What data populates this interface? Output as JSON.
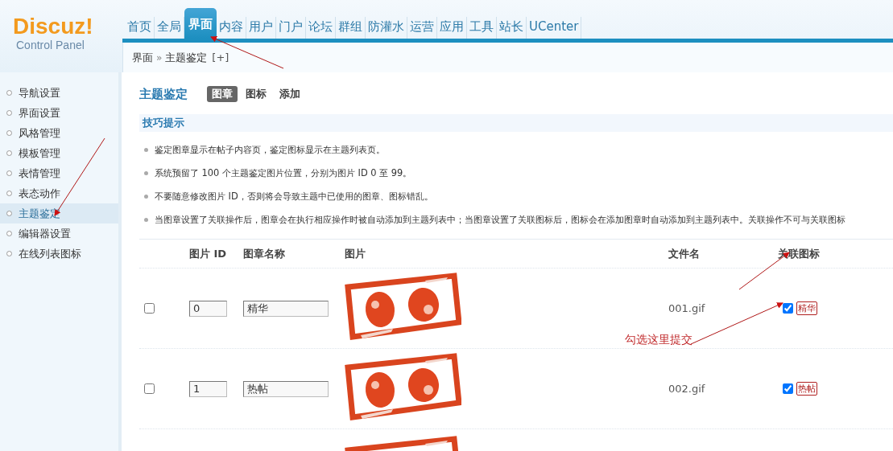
{
  "logo": {
    "name": "Discuz!",
    "subtitle": "Control Panel"
  },
  "nav": [
    {
      "label": "首页",
      "selected": false
    },
    {
      "label": "全局",
      "selected": false
    },
    {
      "label": "界面",
      "selected": true
    },
    {
      "label": "内容",
      "selected": false
    },
    {
      "label": "用户",
      "selected": false
    },
    {
      "label": "门户",
      "selected": false
    },
    {
      "label": "论坛",
      "selected": false
    },
    {
      "label": "群组",
      "selected": false
    },
    {
      "label": "防灌水",
      "selected": false
    },
    {
      "label": "运营",
      "selected": false
    },
    {
      "label": "应用",
      "selected": false
    },
    {
      "label": "工具",
      "selected": false
    },
    {
      "label": "站长",
      "selected": false
    },
    {
      "label": "UCenter",
      "selected": false
    }
  ],
  "breadcrumb": {
    "parent": "界面",
    "separator": "»",
    "current": "主题鉴定",
    "add": "[+]"
  },
  "sidebar": {
    "items": [
      {
        "label": "导航设置",
        "selected": false
      },
      {
        "label": "界面设置",
        "selected": false
      },
      {
        "label": "风格管理",
        "selected": false
      },
      {
        "label": "模板管理",
        "selected": false
      },
      {
        "label": "表情管理",
        "selected": false
      },
      {
        "label": "表态动作",
        "selected": false
      },
      {
        "label": "主题鉴定",
        "selected": true
      },
      {
        "label": "编辑器设置",
        "selected": false
      },
      {
        "label": "在线列表图标",
        "selected": false
      }
    ]
  },
  "page": {
    "title": "主题鉴定",
    "tabs": [
      {
        "label": "图章",
        "selected": true
      },
      {
        "label": "图标",
        "selected": false
      },
      {
        "label": "添加",
        "selected": false
      }
    ]
  },
  "tips": {
    "title": "技巧提示",
    "items": [
      "鉴定图章显示在帖子内容页，鉴定图标显示在主题列表页。",
      "系统预留了 100 个主题鉴定图片位置，分别为图片 ID 0 至 99。",
      "不要随意修改图片 ID，否则将会导致主题中已使用的图章、图标错乱。",
      "当图章设置了关联操作后，图章会在执行相应操作时被自动添加到主题列表中；当图章设置了关联图标后，图标会在添加图章时自动添加到主题列表中。关联操作不可与关联图标"
    ]
  },
  "table": {
    "columns": [
      "图片 ID",
      "图章名称",
      "图片",
      "文件名",
      "关联图标"
    ],
    "rows": [
      {
        "checked": false,
        "id": "0",
        "name": "精华",
        "image": {
          "kind": "picture"
        },
        "file": "001.gif",
        "icon_checked": true,
        "icon_label": "精华"
      },
      {
        "checked": false,
        "id": "1",
        "name": "热帖",
        "image": {
          "kind": "picture"
        },
        "file": "002.gif",
        "icon_checked": true,
        "icon_label": "热帖"
      },
      {
        "image": {
          "kind": "picture"
        }
      }
    ]
  },
  "annotation": {
    "note": "勾选这里提交"
  }
}
